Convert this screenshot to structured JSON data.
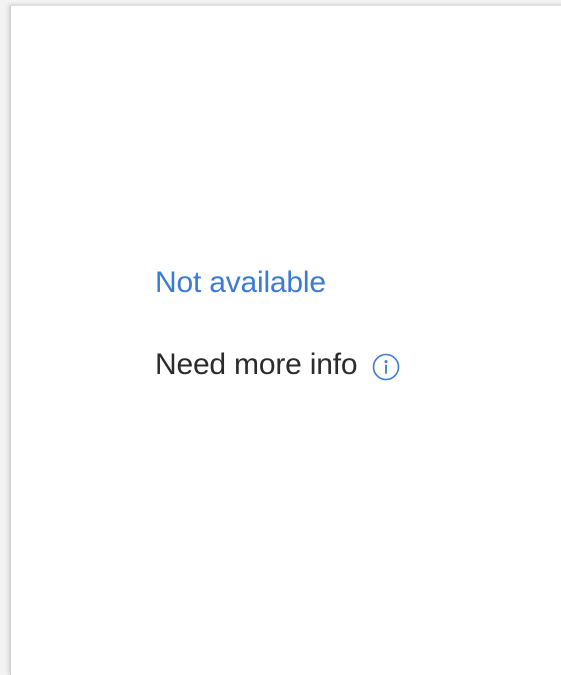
{
  "panel": {
    "status_link_label": "Not available",
    "info_label": "Need more info",
    "info_icon": "info-circle-icon"
  },
  "colors": {
    "link": "#3a7bd5",
    "text": "#2b2b2b",
    "icon": "#3a7bd5",
    "background": "#ffffff"
  }
}
